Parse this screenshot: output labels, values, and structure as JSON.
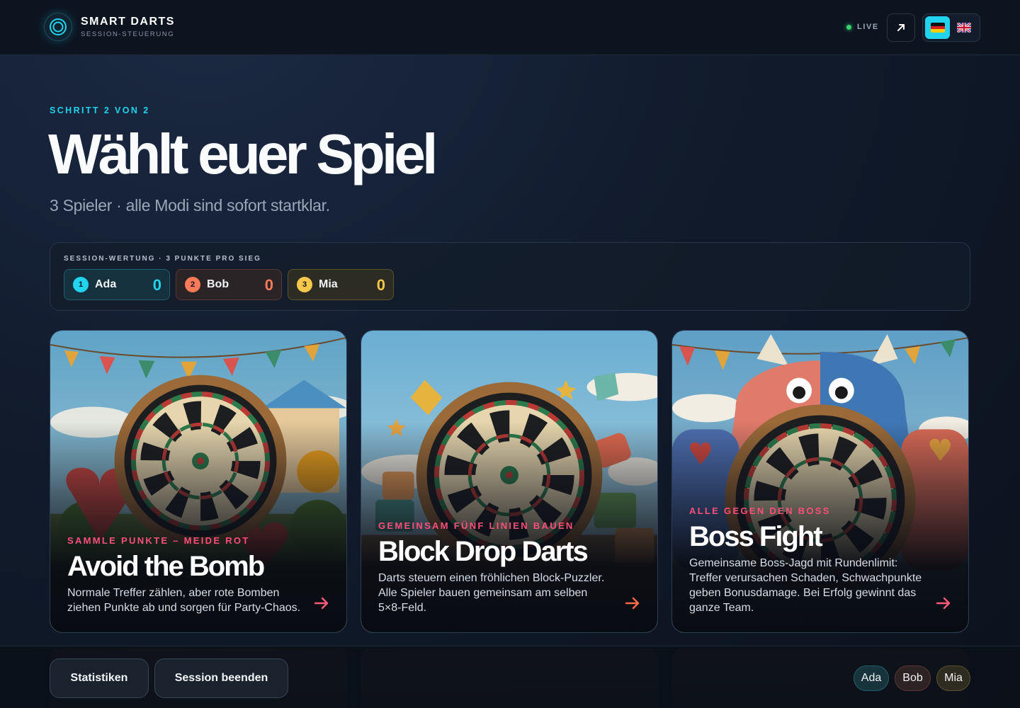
{
  "header": {
    "brand_title": "SMART DARTS",
    "brand_subtitle": "SESSION-STEUERUNG",
    "live_label": "LIVE",
    "external_icon": "arrow-up-right-icon",
    "languages": [
      {
        "code": "de",
        "icon": "german-flag-icon",
        "active": true
      },
      {
        "code": "en",
        "icon": "uk-flag-icon",
        "active": false
      }
    ]
  },
  "hero": {
    "step": "SCHRITT 2 VON 2",
    "title": "Wählt euer Spiel",
    "subtitle": "3 Spieler · alle Modi sind sofort startklar."
  },
  "score": {
    "label": "SESSION-WERTUNG · 3 PUNKTE PRO SIEG",
    "players": [
      {
        "num": "1",
        "name": "Ada",
        "score": "0",
        "color": "#22d3ee"
      },
      {
        "num": "2",
        "name": "Bob",
        "score": "0",
        "color": "#ff7a59"
      },
      {
        "num": "3",
        "name": "Mia",
        "score": "0",
        "color": "#f5c84c"
      }
    ]
  },
  "games": [
    {
      "tagline": "SAMMLE PUNKTE – MEIDE ROT",
      "title": "Avoid the Bomb",
      "description": "Normale Treffer zählen, aber rote Bomben ziehen Punkte ab und sorgen für Party-Chaos.",
      "icon": "arrow-right-icon"
    },
    {
      "tagline": "GEMEINSAM FÜNF LINIEN BAUEN",
      "title": "Block Drop Darts",
      "description": "Darts steuern einen fröhlichen Block-Puzzler. Alle Spieler bauen gemeinsam am selben 5×8-Feld.",
      "icon": "arrow-right-icon"
    },
    {
      "tagline": "ALLE GEGEN DEN BOSS",
      "title": "Boss Fight",
      "description": "Gemeinsame Boss-Jagd mit Rundenlimit: Treffer verursachen Schaden, Schwachpunkte geben Bonusdamage. Bei Erfolg gewinnt das ganze Team.",
      "icon": "arrow-right-icon"
    }
  ],
  "footer": {
    "stats_label": "Statistiken",
    "end_label": "Session beenden",
    "chips": [
      "Ada",
      "Bob",
      "Mia"
    ]
  },
  "colors": {
    "accent": "#22d3ee",
    "live": "#34d36b",
    "tagline": "#ff4f7a",
    "arrow": "#ff5a7a"
  }
}
